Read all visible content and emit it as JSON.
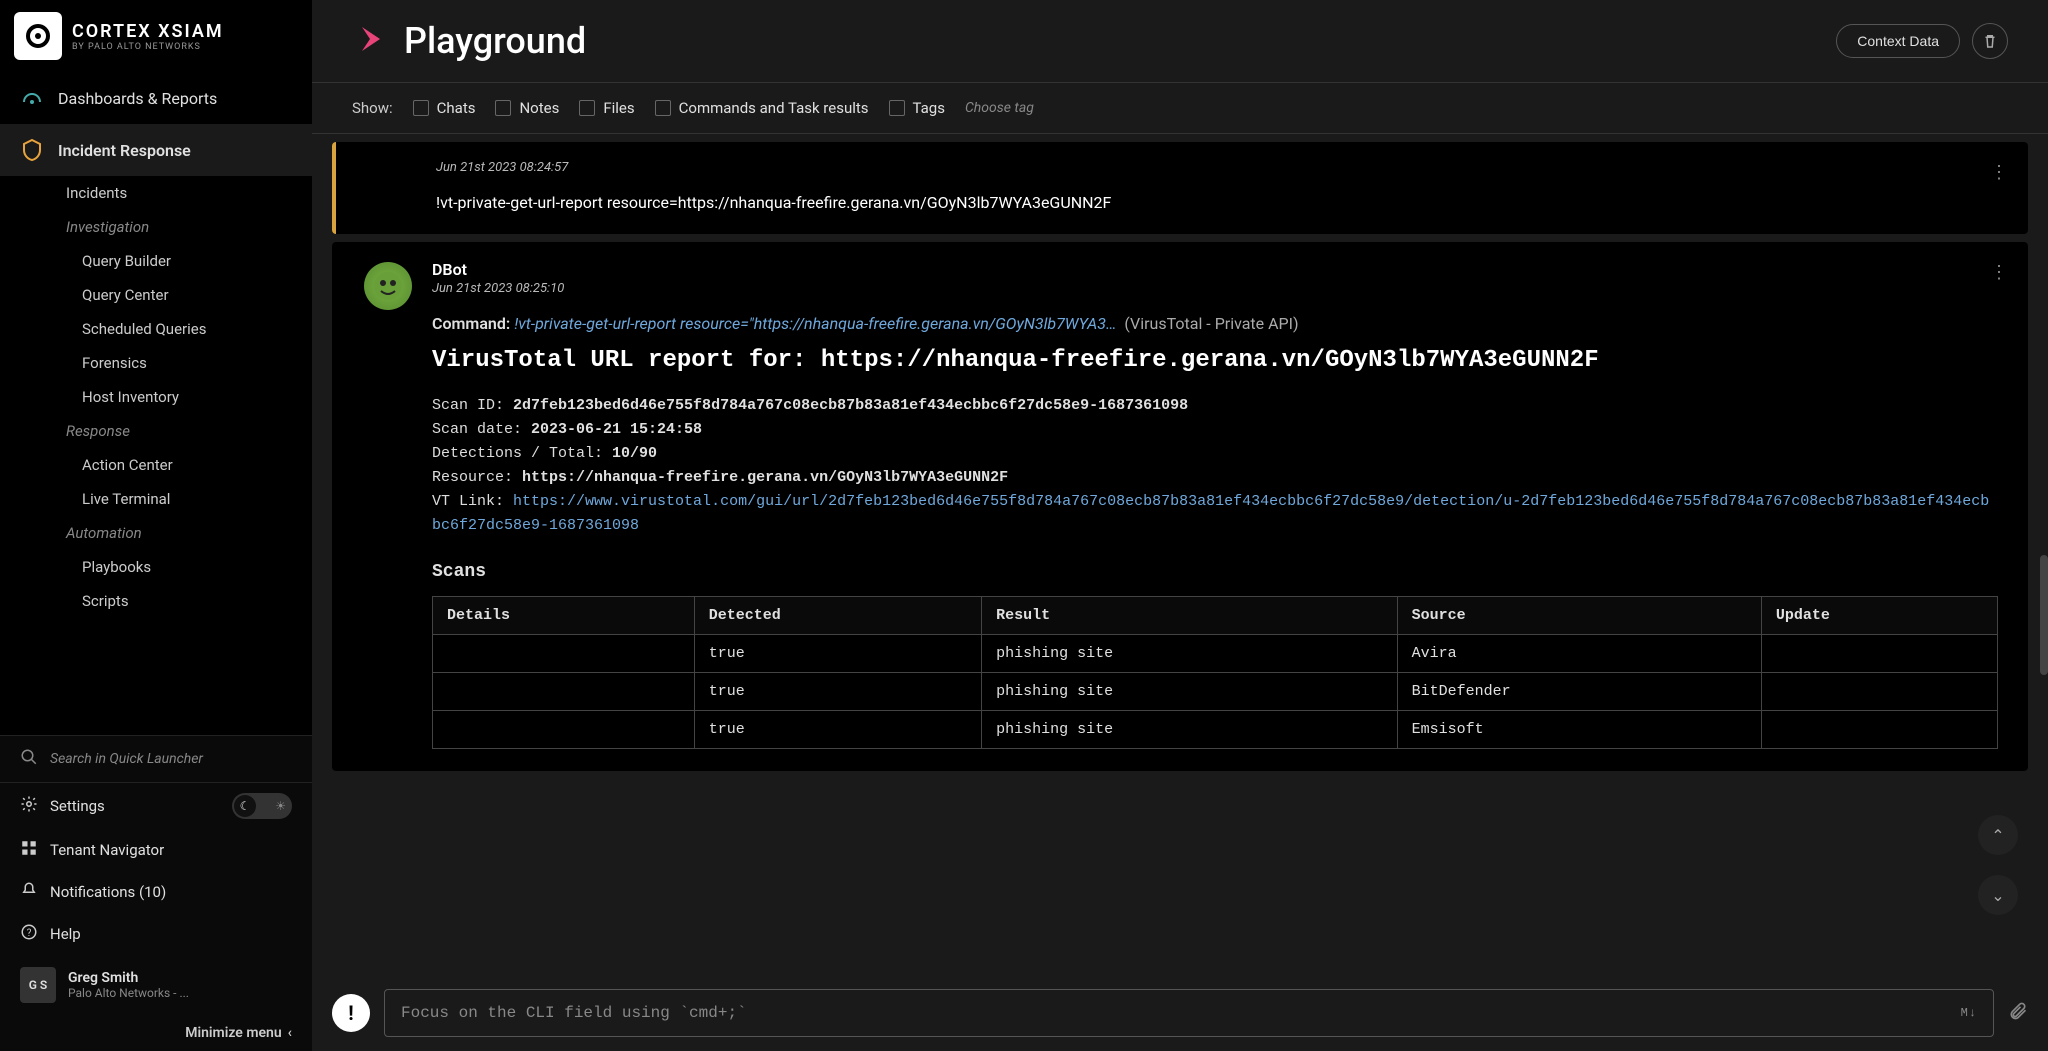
{
  "branding": {
    "product": "CORTEX XSIAM",
    "company": "BY PALO ALTO NETWORKS"
  },
  "nav": {
    "dashboards": "Dashboards & Reports",
    "incident_response": "Incident Response",
    "incidents": "Incidents",
    "investigation": "Investigation",
    "query_builder": "Query Builder",
    "query_center": "Query Center",
    "scheduled_queries": "Scheduled Queries",
    "forensics": "Forensics",
    "host_inventory": "Host Inventory",
    "response": "Response",
    "action_center": "Action Center",
    "live_terminal": "Live Terminal",
    "automation": "Automation",
    "playbooks": "Playbooks",
    "scripts": "Scripts"
  },
  "sidebar_footer": {
    "search_placeholder": "Search in Quick Launcher",
    "settings": "Settings",
    "tenant_navigator": "Tenant Navigator",
    "notifications": "Notifications (10)",
    "help": "Help",
    "user_initials": "G S",
    "user_name": "Greg Smith",
    "user_org": "Palo Alto Networks - ...",
    "minimize": "Minimize menu"
  },
  "page": {
    "title": "Playground",
    "context_data": "Context Data"
  },
  "filters": {
    "label": "Show:",
    "chats": "Chats",
    "notes": "Notes",
    "files": "Files",
    "commands": "Commands and Task results",
    "tags": "Tags",
    "choose_tag": "Choose tag"
  },
  "message1": {
    "time": "Jun 21st 2023 08:24:57",
    "body": "!vt-private-get-url-report resource=https://nhanqua-freefire.gerana.vn/GOyN3lb7WYA3eGUNN2F"
  },
  "message2": {
    "author": "DBot",
    "time": "Jun 21st 2023 08:25:10",
    "command_label": "Command:",
    "command_value": "!vt-private-get-url-report resource=\"https://nhanqua-freefire.gerana.vn/GOyN3lb7WYA3…",
    "integration": "(VirusTotal - Private API)",
    "report_title": "VirusTotal URL report for: https://nhanqua-freefire.gerana.vn/GOyN3lb7WYA3eGUNN2F",
    "scan_id_label": "Scan ID:",
    "scan_id": "2d7feb123bed6d46e755f8d784a767c08ecb87b83a81ef434ecbbc6f27dc58e9-1687361098",
    "scan_date_label": "Scan date:",
    "scan_date": "2023-06-21 15:24:58",
    "detections_label": "Detections / Total:",
    "detections": "10/90",
    "resource_label": "Resource:",
    "resource": "https://nhanqua-freefire.gerana.vn/GOyN3lb7WYA3eGUNN2F",
    "vt_link_label": "VT Link:",
    "vt_link": "https://www.virustotal.com/gui/url/2d7feb123bed6d46e755f8d784a767c08ecb87b83a81ef434ecbbc6f27dc58e9/detection/u-2d7feb123bed6d46e755f8d784a767c08ecb87b83a81ef434ecbbc6f27dc58e9-1687361098",
    "scans_header": "Scans",
    "table": {
      "headers": {
        "details": "Details",
        "detected": "Detected",
        "result": "Result",
        "source": "Source",
        "update": "Update"
      },
      "rows": [
        {
          "details": "",
          "detected": "true",
          "result": "phishing site",
          "source": "Avira",
          "update": ""
        },
        {
          "details": "",
          "detected": "true",
          "result": "phishing site",
          "source": "BitDefender",
          "update": ""
        },
        {
          "details": "",
          "detected": "true",
          "result": "phishing site",
          "source": "Emsisoft",
          "update": ""
        }
      ]
    }
  },
  "cli": {
    "placeholder": "Focus on the CLI field using `cmd+;`",
    "md": "M↓"
  }
}
